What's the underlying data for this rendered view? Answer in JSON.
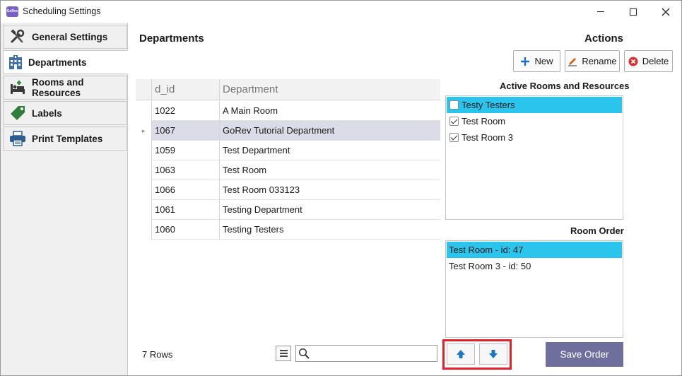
{
  "window": {
    "title": "Scheduling Settings",
    "app_icon_text": "GoRev"
  },
  "sidebar": {
    "items": [
      {
        "label": "General Settings",
        "icon": "tools-icon"
      },
      {
        "label": "Departments",
        "icon": "building-icon",
        "active": true
      },
      {
        "label": "Rooms and Resources",
        "icon": "bed-icon"
      },
      {
        "label": "Labels",
        "icon": "tag-icon"
      },
      {
        "label": "Print Templates",
        "icon": "printer-icon"
      }
    ]
  },
  "main": {
    "title": "Departments",
    "actions_title": "Actions",
    "buttons": {
      "new": "New",
      "rename": "Rename",
      "delete": "Delete"
    },
    "grid": {
      "columns": [
        "d_id",
        "Department"
      ],
      "rows": [
        {
          "id": "1022",
          "dept": "A Main Room"
        },
        {
          "id": "1067",
          "dept": "GoRev Tutorial Department",
          "selected": true,
          "indicator": "▸"
        },
        {
          "id": "1059",
          "dept": "Test Department"
        },
        {
          "id": "1063",
          "dept": "Test Room"
        },
        {
          "id": "1066",
          "dept": "Test Room 033123"
        },
        {
          "id": "1061",
          "dept": "Testing Department"
        },
        {
          "id": "1060",
          "dept": "Testing Testers"
        }
      ]
    },
    "active_rooms": {
      "title": "Active Rooms and Resources",
      "items": [
        {
          "label": "Testy Testers",
          "checked": false,
          "selected": true
        },
        {
          "label": "Test Room",
          "checked": true
        },
        {
          "label": "Test Room 3",
          "checked": true
        }
      ]
    },
    "room_order": {
      "title": "Room Order",
      "items": [
        {
          "label": "Test Room - id: 47",
          "selected": true
        },
        {
          "label": "Test Room 3 - id: 50"
        }
      ]
    },
    "footer": {
      "rows_text": "7 Rows",
      "search_value": "",
      "save_label": "Save Order"
    }
  },
  "colors": {
    "selection_blue": "#2bc4ec",
    "grid_selected": "#dcdce8",
    "save_button": "#6e6f9c",
    "highlight_border": "#e0202a",
    "arrow_blue": "#1a78c2",
    "delete_red": "#d9302c"
  }
}
